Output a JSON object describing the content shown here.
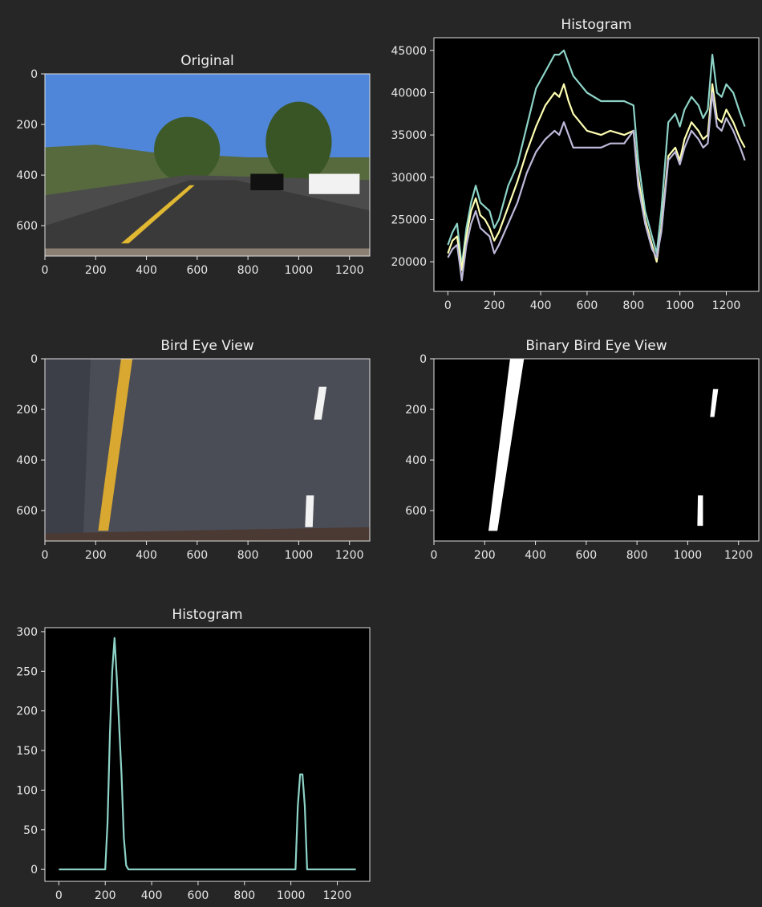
{
  "chart_data": [
    {
      "type": "image",
      "title": "Original",
      "xlim": [
        0,
        1280
      ],
      "ylim": [
        720,
        0
      ],
      "xticks": [
        0,
        200,
        400,
        600,
        800,
        1000,
        1200
      ],
      "yticks": [
        0,
        200,
        400,
        600
      ],
      "colors": {
        "sky": "#4f86d9",
        "road": "#3a3a3a",
        "trees": "#3e5a28",
        "lane_yellow": "#e0b832"
      }
    },
    {
      "type": "line",
      "title": "Histogram",
      "xlim": [
        -60,
        1340
      ],
      "ylim": [
        16500,
        46500
      ],
      "xticks": [
        0,
        200,
        400,
        600,
        800,
        1000,
        1200
      ],
      "yticks": [
        20000,
        25000,
        30000,
        35000,
        40000,
        45000
      ],
      "x": [
        0,
        20,
        40,
        50,
        60,
        80,
        100,
        120,
        140,
        160,
        180,
        200,
        220,
        260,
        300,
        340,
        380,
        420,
        460,
        480,
        500,
        520,
        540,
        600,
        660,
        700,
        760,
        800,
        820,
        850,
        880,
        900,
        920,
        950,
        980,
        1000,
        1020,
        1050,
        1080,
        1100,
        1120,
        1140,
        1160,
        1180,
        1200,
        1230,
        1260,
        1280
      ],
      "series": [
        {
          "color": "#8dd3c7",
          "values": [
            22000,
            23500,
            24500,
            22000,
            19500,
            24000,
            27000,
            29000,
            27000,
            26500,
            26000,
            24000,
            25000,
            29000,
            31500,
            36000,
            40500,
            42500,
            44500,
            44500,
            45000,
            43500,
            42000,
            40000,
            39000,
            39000,
            39000,
            38500,
            32000,
            26000,
            23000,
            21000,
            26000,
            36500,
            37500,
            36000,
            38000,
            39500,
            38500,
            37000,
            38000,
            44500,
            40000,
            39500,
            41000,
            40000,
            37500,
            36000
          ]
        },
        {
          "color": "#ffffb3",
          "values": [
            21000,
            22500,
            23000,
            21000,
            19000,
            23000,
            26000,
            27500,
            25500,
            25000,
            24000,
            22500,
            23500,
            26500,
            29500,
            33000,
            36000,
            38500,
            40000,
            39500,
            41000,
            39000,
            37500,
            35500,
            35000,
            35500,
            35000,
            35500,
            30000,
            25000,
            22000,
            20000,
            24000,
            32500,
            33500,
            32000,
            34500,
            36500,
            35500,
            34500,
            35000,
            41000,
            37000,
            36500,
            38000,
            36500,
            34500,
            33500
          ]
        },
        {
          "color": "#bebada",
          "values": [
            20500,
            21500,
            22000,
            20000,
            17800,
            22000,
            24500,
            26000,
            24000,
            23500,
            23000,
            21000,
            22000,
            24500,
            27000,
            30500,
            33000,
            34500,
            35500,
            35000,
            36500,
            35000,
            33500,
            33500,
            33500,
            34000,
            34000,
            35500,
            29000,
            24500,
            21500,
            20500,
            23500,
            32000,
            33000,
            31500,
            33500,
            35500,
            34500,
            33500,
            34000,
            40000,
            36000,
            35500,
            37000,
            35500,
            33500,
            32000
          ]
        }
      ]
    },
    {
      "type": "image",
      "title": "Bird Eye View",
      "xlim": [
        0,
        1280
      ],
      "ylim": [
        720,
        0
      ],
      "xticks": [
        0,
        200,
        400,
        600,
        800,
        1000,
        1200
      ],
      "yticks": [
        0,
        200,
        400,
        600
      ],
      "colors": {
        "road": "#4a4c56",
        "lane_yellow": "#d9a831",
        "lane_white": "#f2f2f2"
      }
    },
    {
      "type": "image",
      "title": "Binary Bird Eye View",
      "xlim": [
        0,
        1280
      ],
      "ylim": [
        720,
        0
      ],
      "xticks": [
        0,
        200,
        400,
        600,
        800,
        1000,
        1200
      ],
      "yticks": [
        0,
        200,
        400,
        600
      ],
      "colors": {
        "background": "#000000",
        "foreground": "#ffffff"
      }
    },
    {
      "type": "line",
      "title": "Histogram",
      "xlim": [
        -60,
        1340
      ],
      "ylim": [
        -15,
        305
      ],
      "xticks": [
        0,
        200,
        400,
        600,
        800,
        1000,
        1200
      ],
      "yticks": [
        0,
        50,
        100,
        150,
        200,
        250,
        300
      ],
      "x": [
        0,
        200,
        210,
        220,
        230,
        240,
        250,
        260,
        270,
        280,
        290,
        300,
        1000,
        1020,
        1030,
        1040,
        1050,
        1060,
        1070,
        1280
      ],
      "series": [
        {
          "color": "#8dd3c7",
          "values": [
            0,
            0,
            60,
            170,
            250,
            292,
            240,
            180,
            120,
            40,
            5,
            0,
            0,
            0,
            80,
            120,
            120,
            80,
            0,
            0
          ]
        }
      ]
    }
  ]
}
